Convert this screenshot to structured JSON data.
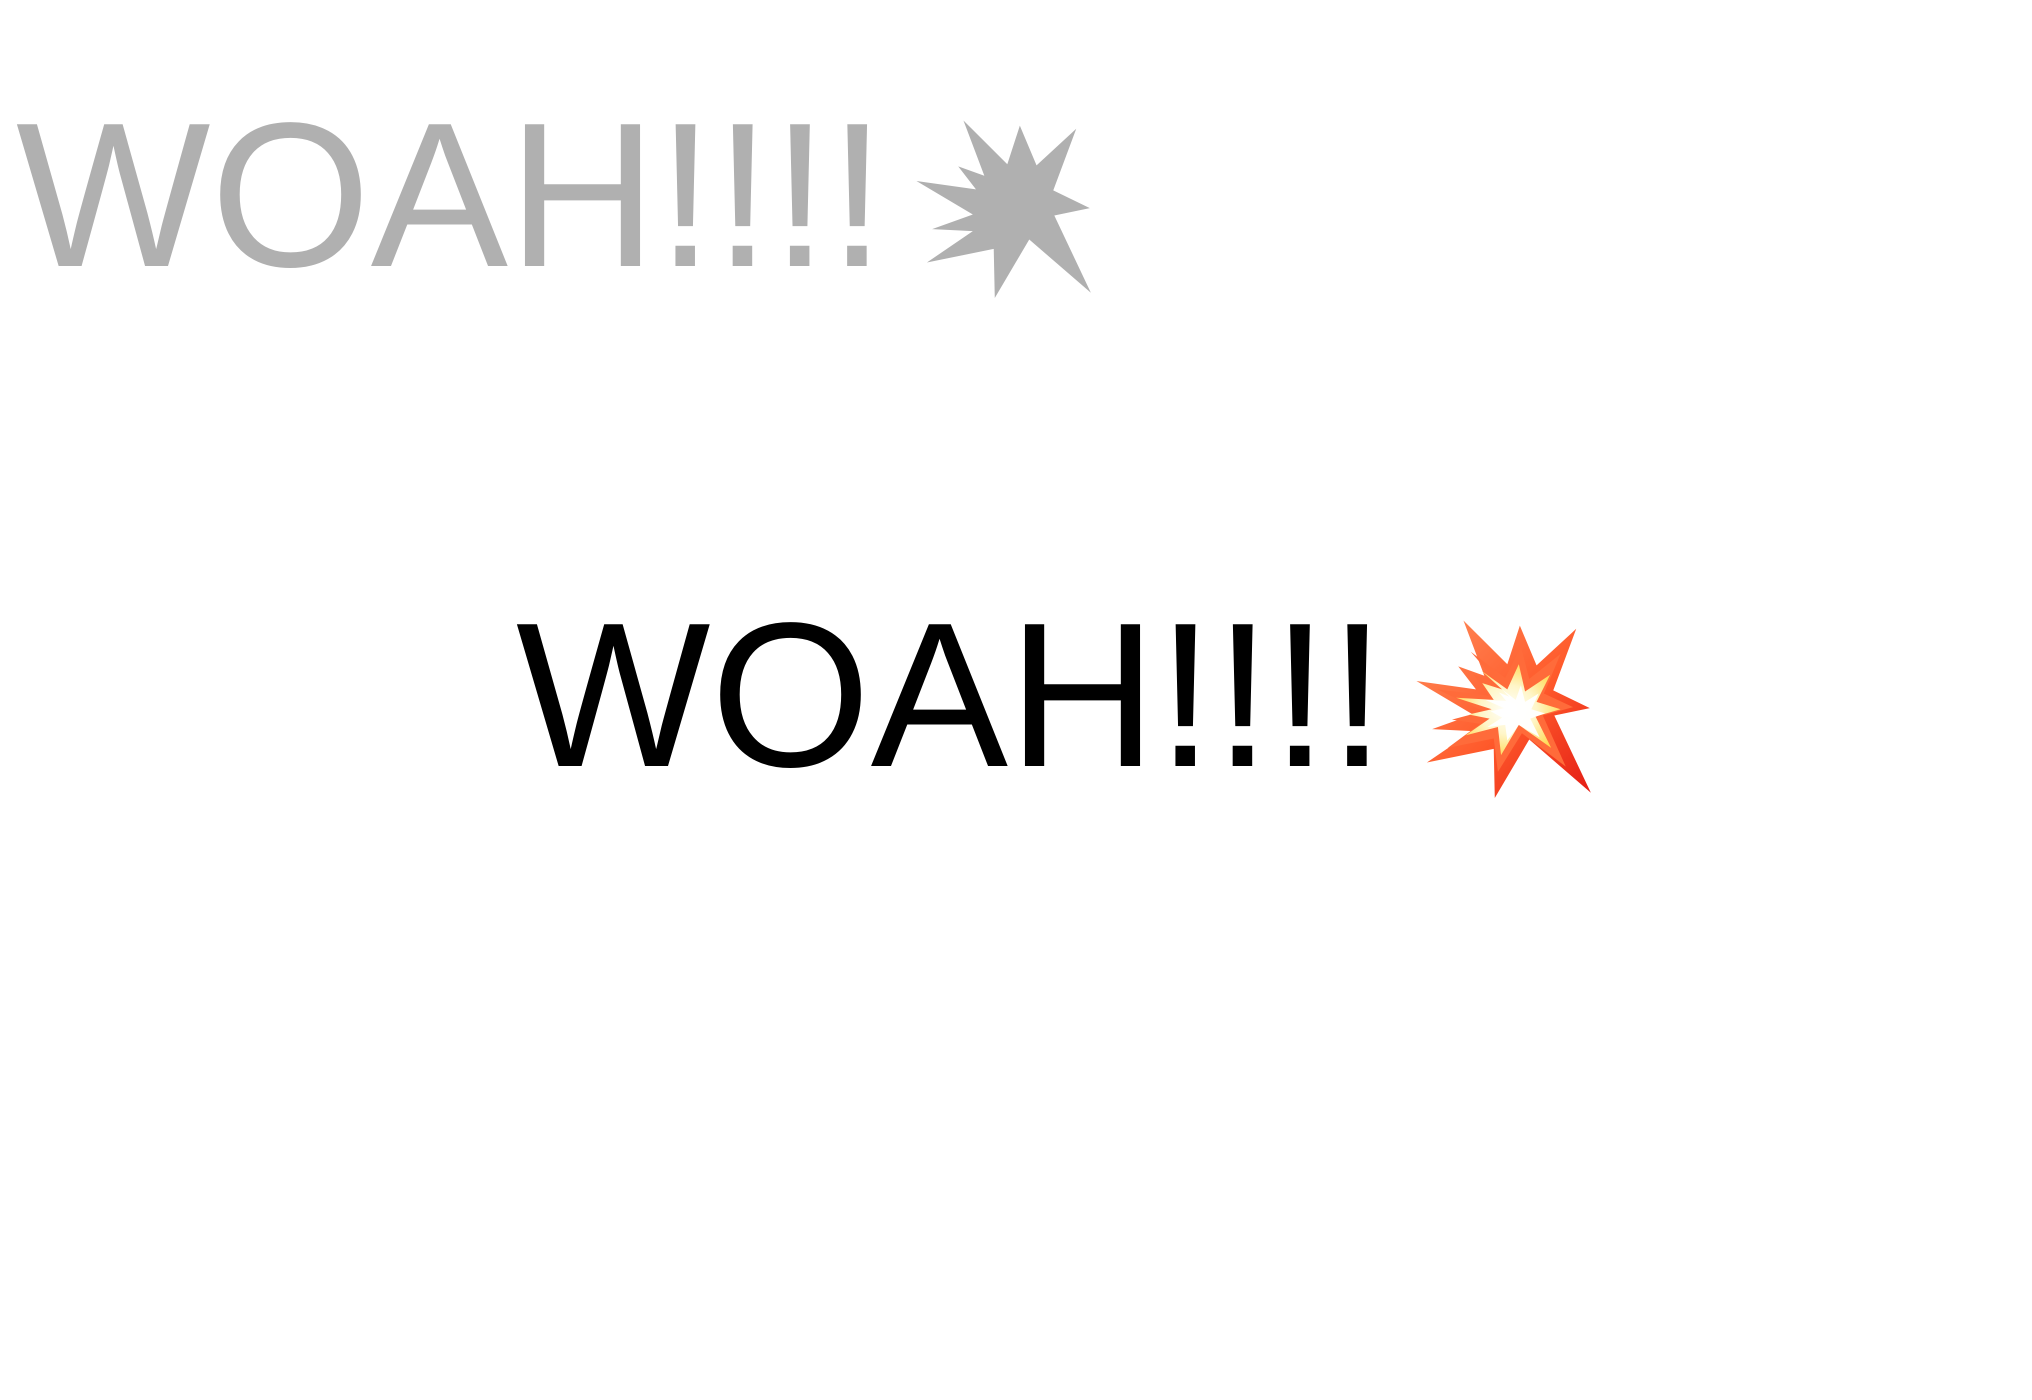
{
  "top": {
    "text": "WOAH!!!!",
    "color": "#b0b0b0",
    "icon": "collision-burst-icon",
    "icon_color": "#b0b0b0"
  },
  "center": {
    "text": "WOAH!!!!",
    "color": "#000000",
    "icon": "collision-emoji-icon",
    "icon_colors": [
      "#e31b14",
      "#ff5a2b",
      "#ffd23a",
      "#fff7c8",
      "#ffffff"
    ]
  }
}
